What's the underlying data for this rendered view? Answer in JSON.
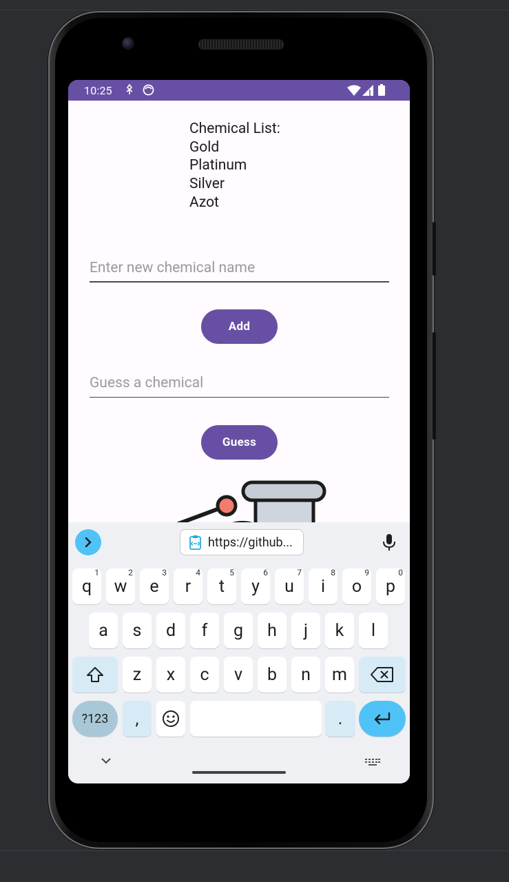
{
  "status_bar": {
    "time": "10:25",
    "left_icons": [
      "flower-icon",
      "face-icon"
    ],
    "right_icons": [
      "wifi-icon",
      "signal-icon",
      "battery-icon"
    ],
    "color": "#6750a4"
  },
  "app": {
    "list_heading": "Chemical List:",
    "chemicals": [
      "Gold",
      "Platinum",
      "Silver",
      "Azot"
    ],
    "new_chemical_input": {
      "value": "",
      "placeholder": "Enter new chemical name"
    },
    "add_button_label": "Add",
    "guess_input": {
      "value": "",
      "placeholder": "Guess a chemical"
    },
    "guess_button_label": "Guess",
    "accent_color": "#6750a4"
  },
  "keyboard": {
    "clipboard_chip_text": "https://github...",
    "row1": [
      {
        "key": "q",
        "hint": "1"
      },
      {
        "key": "w",
        "hint": "2"
      },
      {
        "key": "e",
        "hint": "3"
      },
      {
        "key": "r",
        "hint": "4"
      },
      {
        "key": "t",
        "hint": "5"
      },
      {
        "key": "y",
        "hint": "6"
      },
      {
        "key": "u",
        "hint": "7"
      },
      {
        "key": "i",
        "hint": "8"
      },
      {
        "key": "o",
        "hint": "9"
      },
      {
        "key": "p",
        "hint": "0"
      }
    ],
    "row2": [
      "a",
      "s",
      "d",
      "f",
      "g",
      "h",
      "j",
      "k",
      "l"
    ],
    "row3": [
      "z",
      "x",
      "c",
      "v",
      "b",
      "n",
      "m"
    ],
    "symbols_key": "?123",
    "comma_key": ",",
    "period_key": ".",
    "enter_color": "#4fc3f7"
  }
}
